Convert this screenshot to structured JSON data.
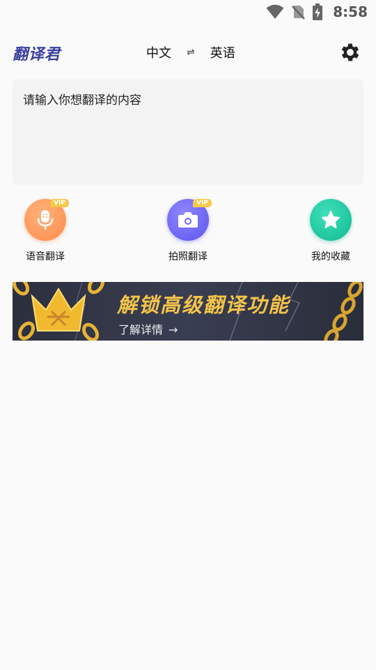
{
  "status_bar": {
    "time": "8:58"
  },
  "app_bar": {
    "logo": "翻译君",
    "source_lang": "中文",
    "swap_symbol": "⇌",
    "target_lang": "英语"
  },
  "input": {
    "placeholder": "请输入你想翻译的内容",
    "value": ""
  },
  "features": {
    "voice": {
      "label": "语音翻译",
      "badge": "VIP"
    },
    "photo": {
      "label": "拍照翻译",
      "badge": "VIP"
    },
    "favorites": {
      "label": "我的收藏"
    }
  },
  "banner": {
    "title": "解锁高级翻译功能",
    "subtitle": "了解详情",
    "arrow": "→"
  },
  "colors": {
    "logo": "#3a3fa0",
    "vip_badge": "#f6c94a",
    "voice": "#ff8a4c",
    "photo": "#5b54f0",
    "favorites": "#13b98f",
    "banner_gold": "#f4c44a"
  }
}
